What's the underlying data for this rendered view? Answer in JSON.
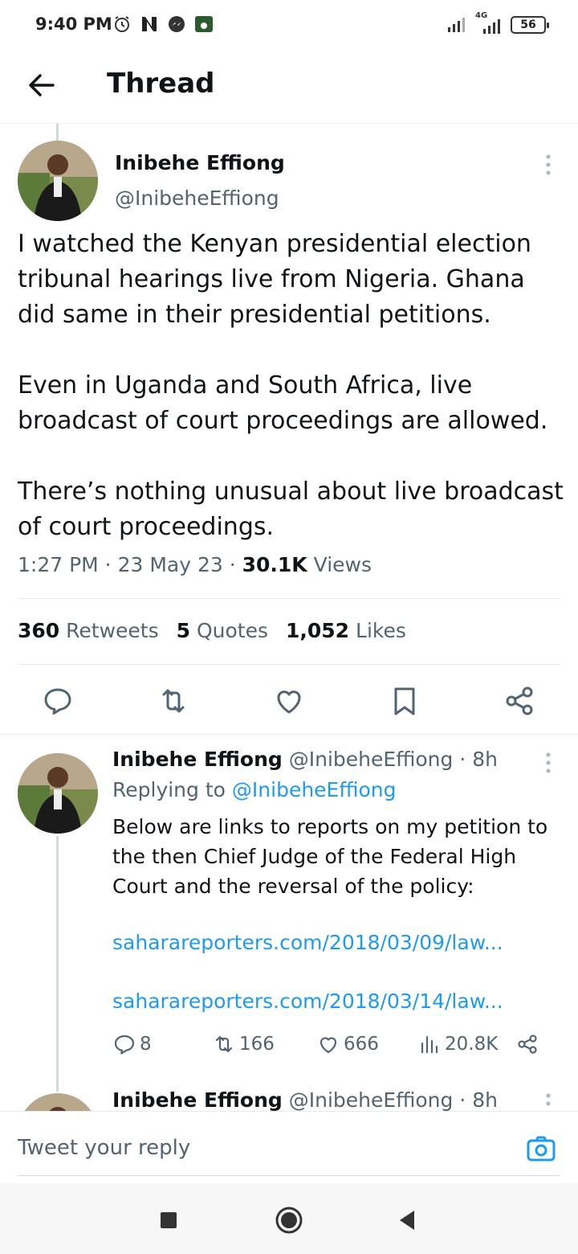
{
  "status_bar": {
    "time": "9:40 PM",
    "network": "4G",
    "battery": "56",
    "icons": [
      "alarm-icon",
      "news-icon",
      "messenger-icon",
      "football-tv-icon",
      "signal-icon"
    ]
  },
  "header": {
    "title": "Thread",
    "back_icon": "arrow-left-icon"
  },
  "main_tweet": {
    "name": "Inibehe Effiong",
    "handle": "@InibeheEffiong",
    "text": "I watched the Kenyan presidential election tribunal hearings live from Nigeria. Ghana did same in their presidential petitions.\n\nEven in Uganda and South Africa, live broadcast of court proceedings are allowed.\n\nThere’s nothing unusual about live broadcast of court proceedings.",
    "time": "1:27 PM",
    "date": "23 May 23",
    "views_count": "30.1K",
    "views_label": "Views",
    "retweets_count": "360",
    "retweets_label": "Retweets",
    "quotes_count": "5",
    "quotes_label": "Quotes",
    "likes_count": "1,052",
    "likes_label": "Likes"
  },
  "reply": {
    "name": "Inibehe Effiong",
    "handle": "@InibeheEffiong",
    "age": "· 8h",
    "replying_prefix": "Replying to",
    "replying_to": "@InibeheEffiong",
    "text": "Below are links to reports on my petition to the then Chief Judge of the Federal High Court and the reversal of the policy:",
    "link1": "saharareporters.com/2018/03/09/law...",
    "link2": "saharareporters.com/2018/03/14/law...",
    "replies": "8",
    "retweets": "166",
    "likes": "666",
    "views": "20.8K"
  },
  "third": {
    "name": "Inibehe Effiong",
    "handle": "@InibeheEffiong",
    "age": "· 8h"
  },
  "composer": {
    "placeholder": "Tweet your reply"
  },
  "colors": {
    "accent": "#1d9bf0",
    "text": "#0f1419",
    "secondary": "#536471"
  }
}
